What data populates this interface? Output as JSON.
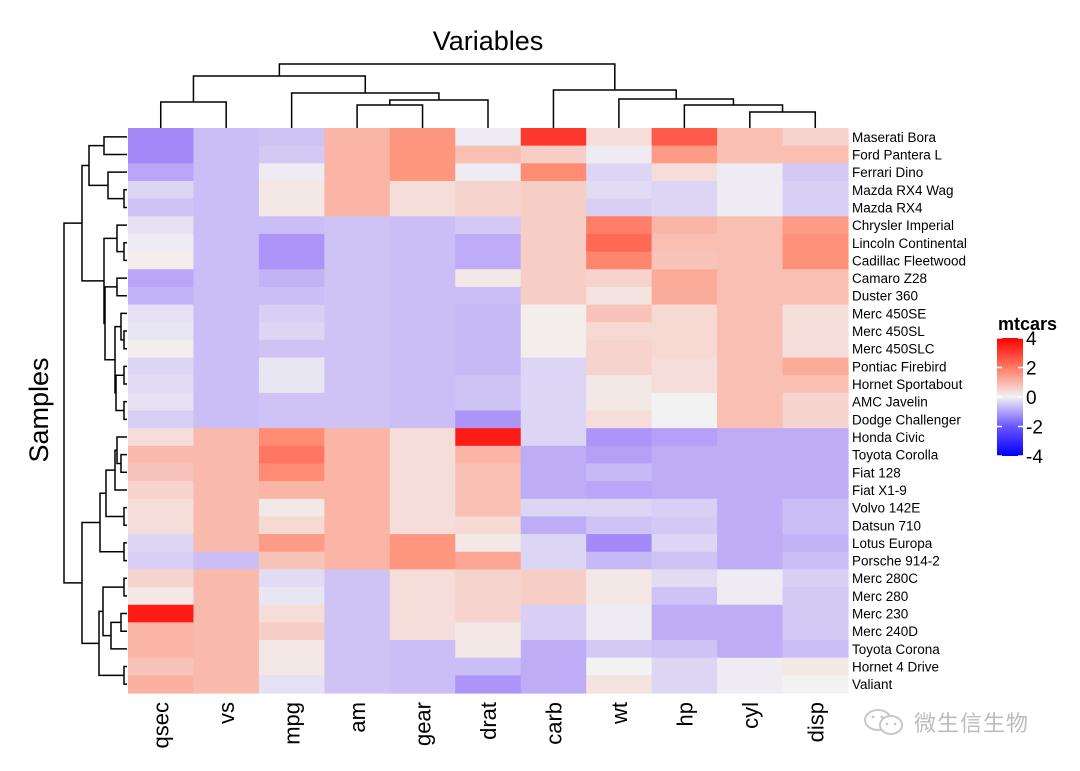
{
  "chart_data": {
    "type": "heatmap",
    "title": "Variables",
    "xlabel": "Variables",
    "ylabel": "Samples",
    "legend": {
      "title": "mtcars",
      "ticks": [
        4,
        2,
        0,
        -2,
        -4
      ],
      "range": [
        -4,
        4
      ],
      "colors": {
        "low": "#0000ff",
        "mid": "#ffffff",
        "high": "#ff0000"
      },
      "placement": "right"
    },
    "columns": [
      "qsec",
      "vs",
      "mpg",
      "am",
      "gear",
      "drat",
      "carb",
      "wt",
      "hp",
      "cyl",
      "disp"
    ],
    "rows": [
      "Maserati Bora",
      "Ford Pantera L",
      "Ferrari Dino",
      "Mazda RX4 Wag",
      "Mazda RX4",
      "Chrysler Imperial",
      "Lincoln Continental",
      "Cadillac Fleetwood",
      "Camaro Z28",
      "Duster 360",
      "Merc 450SE",
      "Merc 450SL",
      "Merc 450SLC",
      "Pontiac Firebird",
      "Hornet Sportabout",
      "AMC Javelin",
      "Dodge Challenger",
      "Honda Civic",
      "Toyota Corolla",
      "Fiat 128",
      "Fiat X1-9",
      "Volvo 142E",
      "Datsun 710",
      "Lotus Europa",
      "Porsche 914-2",
      "Merc 280C",
      "Merc 280",
      "Merc 230",
      "Merc 240D",
      "Toyota Corona",
      "Hornet 4 Drive",
      "Valiant"
    ],
    "values": [
      [
        -1.8,
        -0.9,
        -0.8,
        1.2,
        1.8,
        -0.1,
        3.2,
        0.4,
        2.7,
        1.0,
        0.6
      ],
      [
        -1.8,
        -0.9,
        -0.7,
        1.2,
        1.8,
        1.0,
        0.7,
        -0.1,
        1.7,
        1.0,
        1.0
      ],
      [
        -1.3,
        -0.9,
        -0.1,
        1.2,
        1.8,
        -0.1,
        2.0,
        -0.5,
        0.4,
        -0.1,
        -0.7
      ],
      [
        -0.5,
        -0.9,
        0.2,
        1.2,
        0.4,
        0.6,
        0.7,
        -0.4,
        -0.5,
        -0.1,
        -0.6
      ],
      [
        -0.8,
        -0.9,
        0.2,
        1.2,
        0.4,
        0.6,
        0.7,
        -0.6,
        -0.5,
        -0.1,
        -0.6
      ],
      [
        -0.3,
        -0.9,
        -0.9,
        -0.8,
        -0.9,
        -0.7,
        0.7,
        2.2,
        1.2,
        1.0,
        1.7
      ],
      [
        -0.1,
        -0.9,
        -1.6,
        -0.8,
        -0.9,
        -1.2,
        0.7,
        2.5,
        1.0,
        1.0,
        1.9
      ],
      [
        0.1,
        -0.9,
        -1.6,
        -0.8,
        -0.9,
        -1.2,
        0.7,
        2.1,
        0.9,
        1.0,
        1.9
      ],
      [
        -1.3,
        -0.9,
        -1.1,
        -0.8,
        -0.9,
        0.2,
        0.7,
        0.6,
        1.4,
        1.0,
        1.0
      ],
      [
        -1.1,
        -0.9,
        -0.9,
        -0.8,
        -0.9,
        -0.9,
        0.7,
        0.3,
        1.4,
        1.0,
        1.0
      ],
      [
        -0.3,
        -0.9,
        -0.6,
        -0.8,
        -0.9,
        -1.0,
        0.1,
        0.9,
        0.5,
        1.0,
        0.4
      ],
      [
        -0.2,
        -0.9,
        -0.5,
        -0.8,
        -0.9,
        -1.0,
        0.1,
        0.5,
        0.5,
        1.0,
        0.4
      ],
      [
        0.1,
        -0.9,
        -0.8,
        -0.8,
        -0.9,
        -1.0,
        0.1,
        0.6,
        0.5,
        1.0,
        0.4
      ],
      [
        -0.5,
        -0.9,
        -0.2,
        -0.8,
        -0.9,
        -1.0,
        -0.5,
        0.6,
        0.4,
        1.0,
        1.4
      ],
      [
        -0.4,
        -0.9,
        -0.2,
        -0.8,
        -0.9,
        -0.8,
        -0.5,
        0.2,
        0.4,
        1.0,
        1.0
      ],
      [
        -0.3,
        -0.9,
        -0.8,
        -0.8,
        -0.9,
        -0.8,
        -0.5,
        0.2,
        0.0,
        1.0,
        0.6
      ],
      [
        -0.6,
        -0.9,
        -0.8,
        -0.8,
        -0.9,
        -1.6,
        -0.5,
        0.4,
        0.0,
        1.0,
        0.6
      ],
      [
        0.4,
        1.1,
        2.0,
        1.2,
        0.4,
        3.6,
        -0.5,
        -1.6,
        -1.4,
        -1.2,
        -1.2
      ],
      [
        1.1,
        1.1,
        2.3,
        1.2,
        0.4,
        1.2,
        -1.2,
        -1.4,
        -1.2,
        -1.2,
        -1.2
      ],
      [
        0.9,
        1.1,
        2.0,
        1.2,
        0.4,
        1.0,
        -1.2,
        -1.0,
        -1.2,
        -1.2,
        -1.2
      ],
      [
        0.6,
        1.1,
        1.2,
        1.2,
        0.4,
        1.0,
        -1.2,
        -1.3,
        -1.2,
        -1.2,
        -1.2
      ],
      [
        0.4,
        1.1,
        0.2,
        1.2,
        0.4,
        1.0,
        -0.5,
        -0.5,
        -0.6,
        -1.2,
        -0.9
      ],
      [
        0.4,
        1.1,
        0.5,
        1.2,
        0.4,
        0.5,
        -1.2,
        -0.8,
        -0.7,
        -1.2,
        -0.9
      ],
      [
        -0.5,
        1.1,
        1.7,
        1.2,
        1.8,
        0.2,
        -0.5,
        -1.8,
        -0.5,
        -1.2,
        -1.1
      ],
      [
        -0.6,
        -0.9,
        0.9,
        1.2,
        1.8,
        1.5,
        -0.5,
        -1.0,
        -0.8,
        -1.2,
        -0.9
      ],
      [
        0.6,
        1.1,
        -0.4,
        -0.8,
        0.4,
        0.6,
        0.7,
        0.2,
        -0.4,
        -0.1,
        -0.6
      ],
      [
        0.2,
        1.1,
        -0.2,
        -0.8,
        0.4,
        0.6,
        0.7,
        0.2,
        -0.8,
        -0.1,
        -0.7
      ],
      [
        3.6,
        1.1,
        0.4,
        -0.8,
        0.4,
        0.6,
        -0.6,
        -0.1,
        -1.2,
        -1.2,
        -0.7
      ],
      [
        1.2,
        1.1,
        0.7,
        -0.8,
        0.4,
        0.2,
        -0.6,
        -0.1,
        -1.2,
        -1.2,
        -0.7
      ],
      [
        1.2,
        1.1,
        0.2,
        -0.8,
        -0.9,
        0.2,
        -1.2,
        -0.7,
        -0.8,
        -1.2,
        -0.9
      ],
      [
        0.9,
        1.1,
        0.2,
        -0.8,
        -0.9,
        -0.9,
        -1.2,
        0.0,
        -0.5,
        -0.1,
        0.2
      ],
      [
        1.3,
        1.1,
        -0.3,
        -0.8,
        -0.9,
        -1.6,
        -1.2,
        0.3,
        -0.5,
        -0.1,
        0.0
      ]
    ],
    "col_dendrogram": true,
    "row_dendrogram": true
  },
  "watermark": {
    "text": "微生信生物",
    "icon": "wechat-icon"
  }
}
